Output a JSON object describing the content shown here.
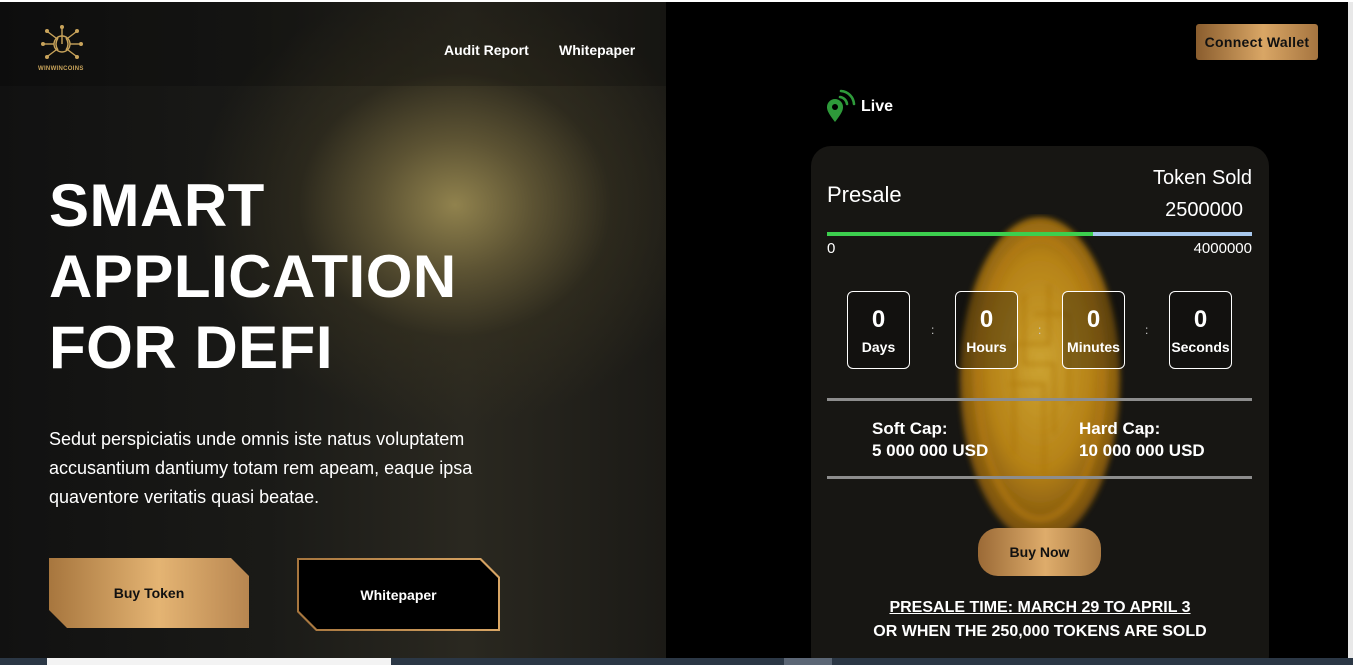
{
  "header": {
    "logo_text": "WINWINCOINS",
    "nav": [
      {
        "label": "Audit Report"
      },
      {
        "label": "Whitepaper"
      }
    ],
    "connect_wallet_label": "Connect Wallet"
  },
  "hero": {
    "title_lines": [
      "SMART",
      "APPLICATION",
      "FOR DEFI"
    ],
    "description": "Sedut perspiciatis unde omnis iste natus voluptatem accusantium dantiumy totam rem apeam, eaque ipsa quaventore veritatis quasi beatae.",
    "buy_token_label": "Buy Token",
    "whitepaper_label": "Whitepaper"
  },
  "presale": {
    "live_label": "Live",
    "title": "Presale",
    "token_sold_label": "Token Sold",
    "token_sold_value": "2500000",
    "range_min": "0",
    "range_max": "4000000",
    "progress_fraction": 0.625,
    "countdown": [
      {
        "value": "0",
        "unit": "Days"
      },
      {
        "value": "0",
        "unit": "Hours"
      },
      {
        "value": "0",
        "unit": "Minutes"
      },
      {
        "value": "0",
        "unit": "Seconds"
      }
    ],
    "countdown_separator": ":",
    "soft_cap_label": "Soft Cap:",
    "soft_cap_value": "5 000 000 USD",
    "hard_cap_label": "Hard Cap:",
    "hard_cap_value": "10 000 000 USD",
    "buy_now_label": "Buy Now",
    "presale_time": "PRESALE TIME: MARCH 29 TO APRIL 3",
    "presale_condition": "OR WHEN THE 250,000 TOKENS ARE SOLD"
  },
  "colors": {
    "accent_gold": "#d9a665",
    "live_green": "#2e9a3a",
    "progress_green": "#3ccf4e",
    "progress_track": "#a8c8ee"
  },
  "icons": {
    "logo": "brain-circuit-logo-icon",
    "live": "location-pin-signal-icon",
    "coin": "gold-coin-icon"
  }
}
